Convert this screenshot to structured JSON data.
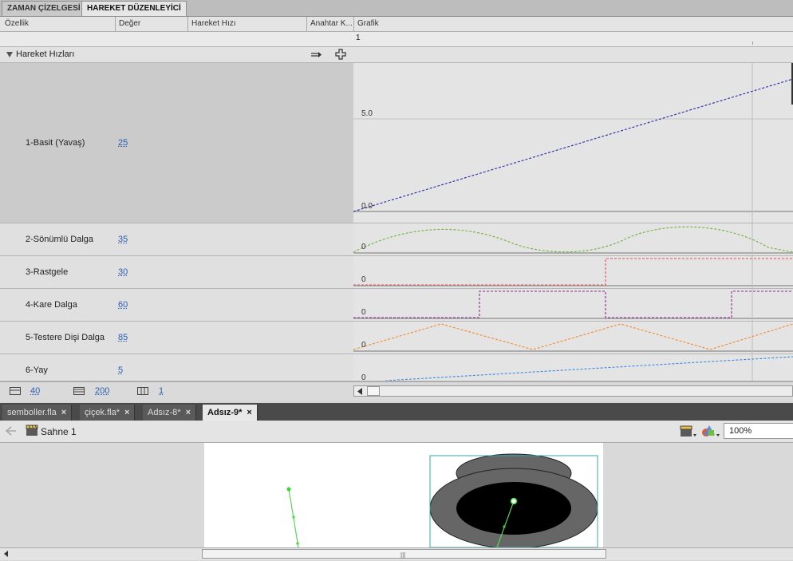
{
  "tabs": {
    "timeline": "ZAMAN ÇİZELGESİ",
    "motion_editor": "HAREKET DÜZENLEYİCİ"
  },
  "columns": {
    "property": "Özellik",
    "value": "Değer",
    "ease": "Hareket Hızı",
    "keyframe": "Anahtar K...",
    "graph": "Grafik"
  },
  "ruler": {
    "frame": "1"
  },
  "section": {
    "label": "Hareket Hızları"
  },
  "graph_scale": {
    "top": "5.0",
    "bottom": "0.0"
  },
  "eases": [
    {
      "label": "1-Basit (Yavaş)",
      "value": "25",
      "zero": ""
    },
    {
      "label": "2-Sönümlü Dalga",
      "value": "35",
      "zero": "0"
    },
    {
      "label": "3-Rastgele",
      "value": "30",
      "zero": "0"
    },
    {
      "label": "4-Kare Dalga",
      "value": "60",
      "zero": "0"
    },
    {
      "label": "5-Testere Dişi Dalga",
      "value": "85",
      "zero": "0"
    },
    {
      "label": "6-Yay",
      "value": "5",
      "zero": "0"
    }
  ],
  "footer": {
    "graph_size": "40",
    "expanded_size": "200",
    "viewable_frames": "1"
  },
  "documents": [
    {
      "name": "semboller.fla",
      "active": false
    },
    {
      "name": "çiçek.fla*",
      "active": false
    },
    {
      "name": "Adsız-8*",
      "active": false
    },
    {
      "name": "Adsız-9*",
      "active": true
    }
  ],
  "editbar": {
    "scene": "Sahne 1",
    "zoom": "100%"
  },
  "colors": {
    "ease1": "#2a2aa8",
    "ease2": "#6fb43a",
    "ease3": "#e0505a",
    "ease4": "#8a2a8a",
    "ease5": "#f08a2a",
    "ease6": "#3a8ae0",
    "link": "#2a5db0",
    "selection": "#33aaaa"
  },
  "icons": {
    "collapse": "triangle-down-icon",
    "reset": "reset-icon",
    "add": "add-icon",
    "back": "back-arrow-icon",
    "scene": "clapperboard-icon",
    "edit_scene": "edit-scene-icon",
    "edit_symbol": "edit-symbol-icon",
    "graph_size": "graph-size-icon",
    "expanded_graph": "expanded-graph-size-icon",
    "frames": "viewable-frames-icon",
    "close": "close-icon"
  }
}
